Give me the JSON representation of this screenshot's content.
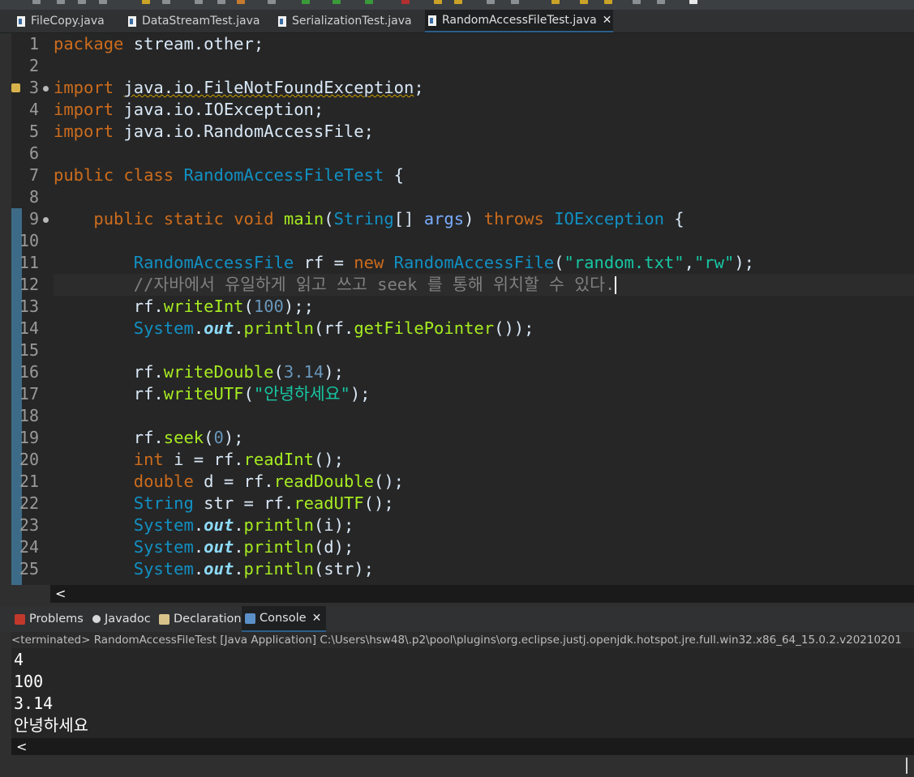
{
  "tabs": [
    {
      "label": "FileCopy.java"
    },
    {
      "label": "DataStreamTest.java"
    },
    {
      "label": "SerializationTest.java"
    },
    {
      "label": "RandomAccessFileTest.java",
      "active": true
    }
  ],
  "editor": {
    "line_numbers": [
      "1",
      "2",
      "3",
      "4",
      "5",
      "6",
      "7",
      "8",
      "9",
      "10",
      "11",
      "12",
      "13",
      "14",
      "15",
      "16",
      "17",
      "18",
      "19",
      "20",
      "21",
      "22",
      "23",
      "24",
      "25"
    ],
    "code_lines": [
      "package stream.other;",
      "",
      "import java.io.FileNotFoundException;",
      "import java.io.IOException;",
      "import java.io.RandomAccessFile;",
      "",
      "public class RandomAccessFileTest {",
      "",
      "    public static void main(String[] args) throws IOException {",
      "",
      "        RandomAccessFile rf = new RandomAccessFile(\"random.txt\",\"rw\");",
      "        //자바에서 유일하게 읽고 쓰고 seek 를 통해 위치할 수 있다.",
      "        rf.writeInt(100);;",
      "        System.out.println(rf.getFilePointer());",
      "",
      "        rf.writeDouble(3.14);",
      "        rf.writeUTF(\"안녕하세요\");",
      "",
      "        rf.seek(0);",
      "        int i = rf.readInt();",
      "        double d = rf.readDouble();",
      "        String str = rf.readUTF();",
      "        System.out.println(i);",
      "        System.out.println(d);",
      "        System.out.println(str);"
    ]
  },
  "scroll_left_glyph": "<",
  "panel_tabs": [
    {
      "label": "Problems",
      "icon": "problems-icon"
    },
    {
      "label": "Javadoc",
      "icon": "javadoc-icon"
    },
    {
      "label": "Declaration",
      "icon": "declaration-icon"
    },
    {
      "label": "Console",
      "icon": "console-icon",
      "active": true
    }
  ],
  "console": {
    "header": "<terminated> RandomAccessFileTest [Java Application] C:\\Users\\hsw48\\.p2\\pool\\plugins\\org.eclipse.justj.openjdk.hotspot.jre.full.win32.x86_64_15.0.2.v20210201",
    "output": [
      "4",
      "100",
      "3.14",
      "안녕하세요"
    ]
  },
  "colors": {
    "keyword": "#cc6c1d",
    "type": "#1290c3",
    "method": "#a7ec21",
    "string": "#17c6a3",
    "number": "#6897bb",
    "comment": "#808080",
    "active_tab_border": "#2c5f8a"
  }
}
